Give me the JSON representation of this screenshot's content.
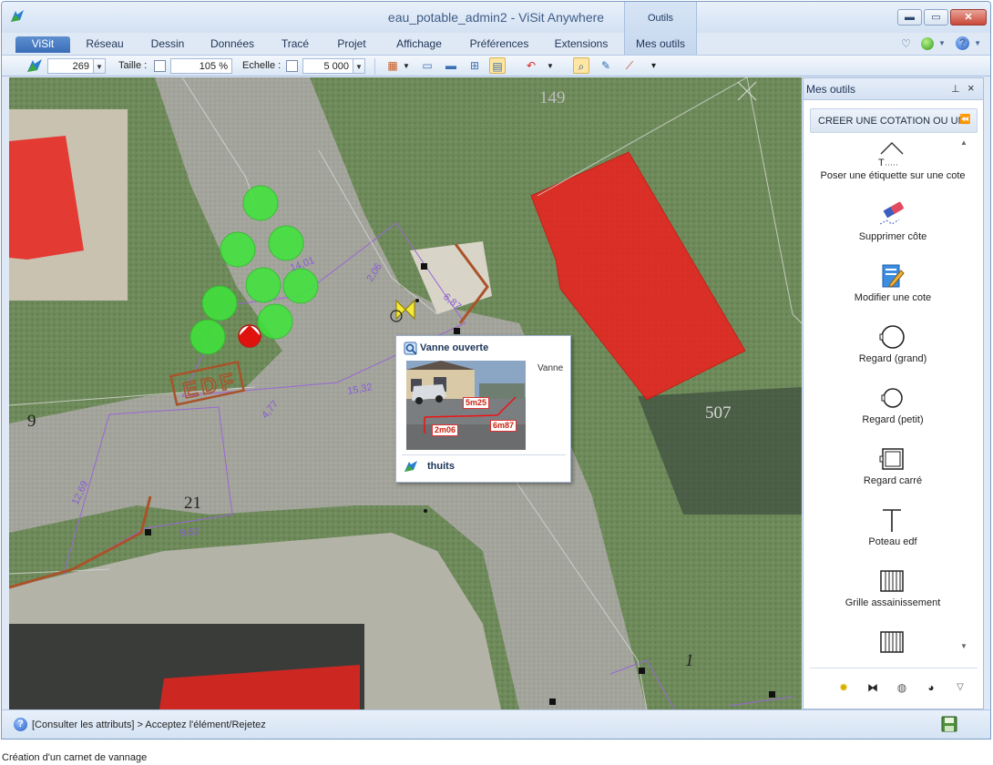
{
  "window": {
    "document_name": "eau_potable_admin2",
    "app_name": " - ViSit Anywhere",
    "context_tab_group": "Outils",
    "minimize_glyph": "▬",
    "maximize_glyph": "▭",
    "close_glyph": "✕"
  },
  "ribbon": {
    "tabs": [
      "ViSit",
      "Réseau",
      "Dessin",
      "Données",
      "Tracé",
      "Projet",
      "Affichage",
      "Préférences",
      "Extensions",
      "Mes outils"
    ],
    "active_tab": "ViSit"
  },
  "toolbar": {
    "layer_value": "269",
    "taille_label": "Taille :",
    "taille_value": "105 %",
    "echelle_label": "Echelle :",
    "echelle_value": "5 000",
    "more_glyph": "▾"
  },
  "popup": {
    "title": "Vanne ouverte",
    "type_label": "Vanne",
    "footer": "thuits",
    "photo_labels": [
      "5m25",
      "2m06",
      "6m87"
    ]
  },
  "panel": {
    "title": "Mes outils",
    "group_label": "CREER UNE COTATION OU UN",
    "tools": [
      {
        "label": "Poser une étiquette sur une cote",
        "icon": "dimension-label-icon"
      },
      {
        "label": "Supprimer côte",
        "icon": "eraser-icon"
      },
      {
        "label": "Modifier une cote",
        "icon": "edit-document-icon"
      },
      {
        "label": "Regard (grand)",
        "icon": "manhole-large-icon"
      },
      {
        "label": "Regard (petit)",
        "icon": "manhole-small-icon"
      },
      {
        "label": "Regard carré",
        "icon": "manhole-square-icon"
      },
      {
        "label": "Poteau edf",
        "icon": "power-pole-icon"
      },
      {
        "label": "Grille assainissement",
        "icon": "drain-grid-icon"
      },
      {
        "label": "",
        "icon": "drain-grid-icon"
      }
    ]
  },
  "map": {
    "dimension_labels": [
      "2,06",
      "6,87",
      "14,01",
      "15,32",
      "4,77",
      "12,69",
      "9,52"
    ],
    "parcel_numbers": [
      "149",
      "507",
      "9",
      "21",
      "1"
    ],
    "edf_label": "EDF"
  },
  "status": {
    "text": "[Consulter les attributs] > Acceptez l'élément/Rejetez"
  },
  "caption": "Création d'un carnet de vannage",
  "colors": {
    "building_red": "#e8231f",
    "tree_green": "#3ee63a",
    "parcel_line": "#9a66d6",
    "network_brown": "#a9532a",
    "ribbon_active": "#3a6db7"
  }
}
